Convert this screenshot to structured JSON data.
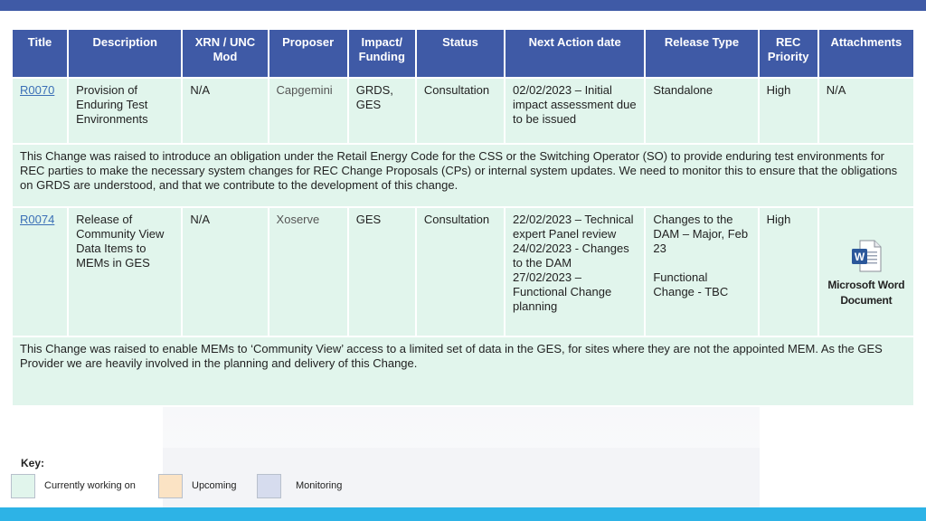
{
  "table": {
    "headers": [
      "Title",
      "Description",
      "XRN / UNC Mod",
      "Proposer",
      "Impact/ Funding",
      "Status",
      "Next Action date",
      "Release Type",
      "REC Priority",
      "Attachments"
    ],
    "rows": [
      {
        "title": "R0070",
        "description": "Provision of Enduring Test Environments",
        "xrn": "N/A",
        "proposer": "Capgemini",
        "impact": "GRDS, GES",
        "status": "Consultation",
        "next_action": [
          "02/02/2023 – Initial impact assessment due to be issued"
        ],
        "release_type": [
          "Standalone"
        ],
        "priority": "High",
        "attachments": "N/A",
        "summary": "This Change was raised to introduce an obligation under the Retail Energy Code for the CSS or the Switching Operator (SO) to provide enduring test environments for REC parties to make the necessary system changes for REC Change Proposals (CPs) or internal system updates. We need to monitor this to ensure that the obligations on GRDS are understood, and that we contribute to the development of this change."
      },
      {
        "title": "R0074",
        "description": "Release of Community View Data Items to MEMs in GES",
        "xrn": "N/A",
        "proposer": "Xoserve",
        "impact": "GES",
        "status": "Consultation",
        "next_action": [
          "22/02/2023 – Technical expert Panel review",
          "24/02/2023 - Changes to the DAM",
          "27/02/2023 – Functional Change planning"
        ],
        "release_type": [
          "Changes to the DAM – Major, Feb 23",
          "Functional Change - TBC"
        ],
        "priority": "High",
        "attachment_label": [
          "Microsoft Word",
          "Document"
        ],
        "summary": "This Change was raised to enable MEMs to ‘Community View’ access to a limited set of data in the GES, for sites where they are not the appointed MEM. As the GES Provider we are heavily involved in the planning and delivery of this Change."
      }
    ]
  },
  "key": {
    "title": "Key:",
    "items": [
      {
        "label": "Currently working on",
        "color": "#e1f5ec"
      },
      {
        "label": "Upcoming",
        "color": "#fbe3c4"
      },
      {
        "label": "Monitoring",
        "color": "#d6dcee"
      }
    ]
  },
  "colors": {
    "header": "#3f5aa6",
    "row": "#e1f5ec",
    "top_bar": "#3f5aa6",
    "bottom_bar": "#2db3e6"
  }
}
